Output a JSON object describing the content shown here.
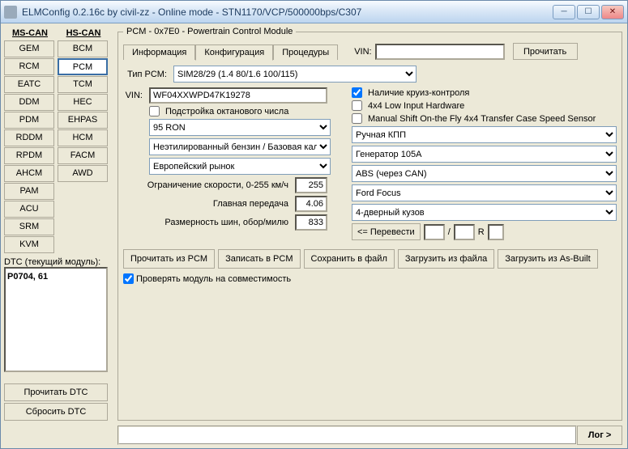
{
  "title": "ELMConfig 0.2.16c by civil-zz - Online mode - STN1170/VCP/500000bps/C307",
  "sidebar": {
    "mscan_hdr": "MS-CAN",
    "hscan_hdr": "HS-CAN",
    "ms_items": [
      "GEM",
      "RCM",
      "EATC",
      "DDM",
      "PDM",
      "RDDM",
      "RPDM",
      "AHCM",
      "PAM",
      "ACU",
      "SRM",
      "KVM"
    ],
    "hs_items": [
      "BCM",
      "PCM",
      "TCM",
      "HEC",
      "EHPAS",
      "HCM",
      "FACM",
      "AWD"
    ],
    "dtc_label": "DTC (текущий модуль):",
    "dtc_value": "P0704, 61",
    "read_dtc": "Прочитать DTC",
    "clear_dtc": "Сбросить DTC"
  },
  "main": {
    "legend": "PCM - 0x7E0 - Powertrain Control Module",
    "tabs": [
      "Информация",
      "Конфигурация",
      "Процедуры"
    ],
    "vin_lbl": "VIN:",
    "vin_top": "",
    "read_btn": "Прочитать",
    "type_lbl": "Тип PCM:",
    "type_val": "SIM28/29 (1.4 80/1.6 100/115)",
    "vin_lbl2": "VIN:",
    "vin_val": "WF04XXWPD47K19278",
    "oct_chk": "Подстройка октанового числа",
    "ron": "95 RON",
    "fuel": "Неэтилированный бензин / Базовая калибров",
    "market": "Европейский рынок",
    "speed_lbl": "Ограничение скорости, 0-255 км/ч",
    "speed_val": "255",
    "final_lbl": "Главная передача",
    "final_val": "4.06",
    "tire_lbl": "Размерность шин, обор/милю",
    "tire_val": "833",
    "convert": "<= Перевести",
    "slash": "/",
    "r": "R",
    "cruise": "Наличие круиз-контроля",
    "low4x4": "4x4 Low Input Hardware",
    "shift4x4": "Manual Shift On-the Fly 4x4 Transfer Case Speed Sensor",
    "trans": "Ручная КПП",
    "alt": "Генератор 105A",
    "abs": "ABS (через CAN)",
    "model": "Ford Focus",
    "body": "4-дверный кузов",
    "btn_read": "Прочитать из PCM",
    "btn_write": "Записать в PCM",
    "btn_save": "Сохранить в файл",
    "btn_load": "Загрузить из файла",
    "btn_asbuilt": "Загрузить из As-Built",
    "compat": "Проверять модуль на совместимость",
    "log_btn": "Лог >"
  }
}
